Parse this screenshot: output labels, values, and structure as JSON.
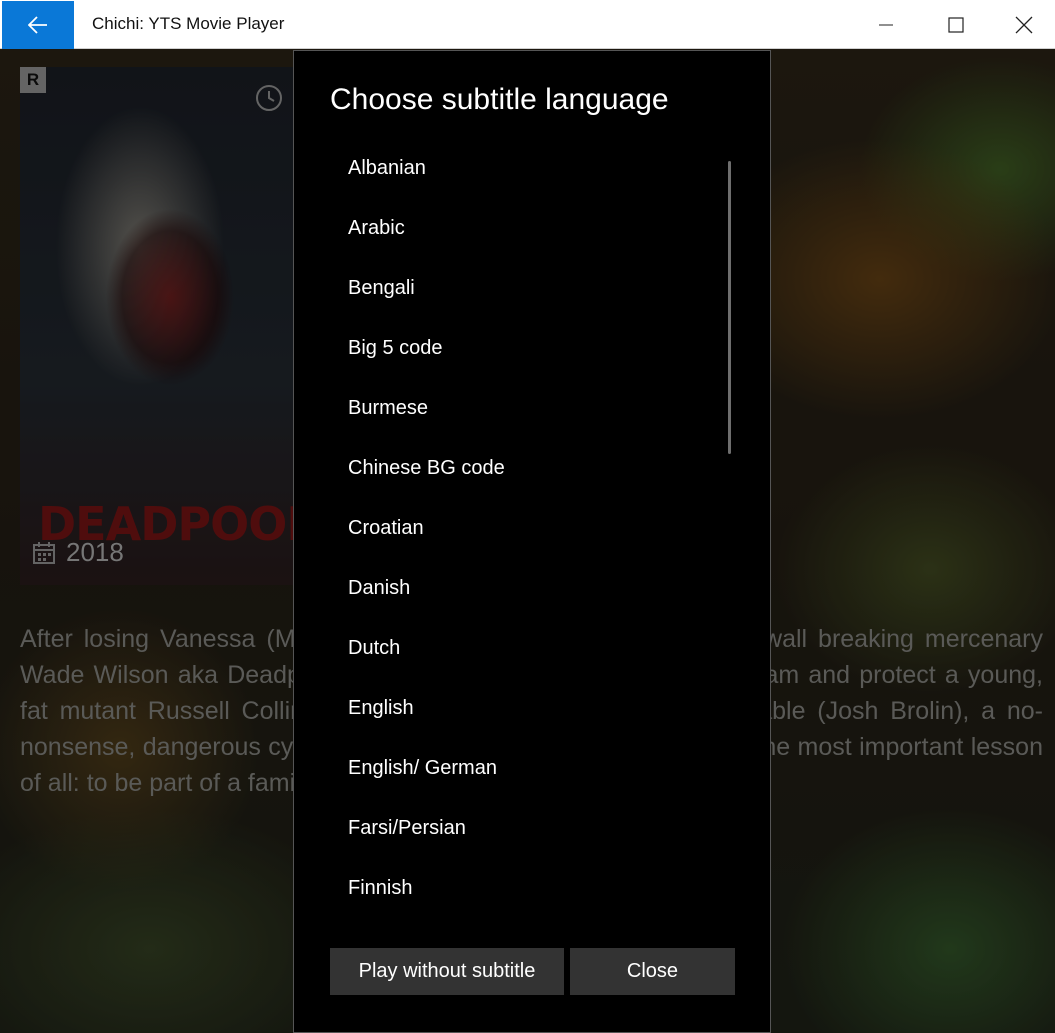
{
  "window": {
    "title": "Chichi: YTS Movie Player"
  },
  "movie": {
    "rating": "R",
    "poster_title": "DEADPOOL",
    "year": "2018",
    "synopsis": "After losing Vanessa (Morena Baccarin), the love of his life, 4th-wall breaking mercenary Wade Wilson aka Deadpool (Ryan Reynolds) must assemble a team and protect a young, fat mutant Russell Collins aka Firefist (Julian Dennison) from Cable (Josh Brolin), a no-nonsense, dangerous cyborg from the future, and must also learn the most important lesson of all: to be part of a family again. —ahmetkozan"
  },
  "dialog": {
    "title": "Choose subtitle language",
    "languages": [
      "Albanian",
      "Arabic",
      "Bengali",
      "Big 5 code",
      "Burmese",
      "Chinese BG code",
      "Croatian",
      "Danish",
      "Dutch",
      "English",
      "English/ German",
      "Farsi/Persian",
      "Finnish"
    ],
    "play_without_label": "Play without subtitle",
    "close_label": "Close"
  }
}
